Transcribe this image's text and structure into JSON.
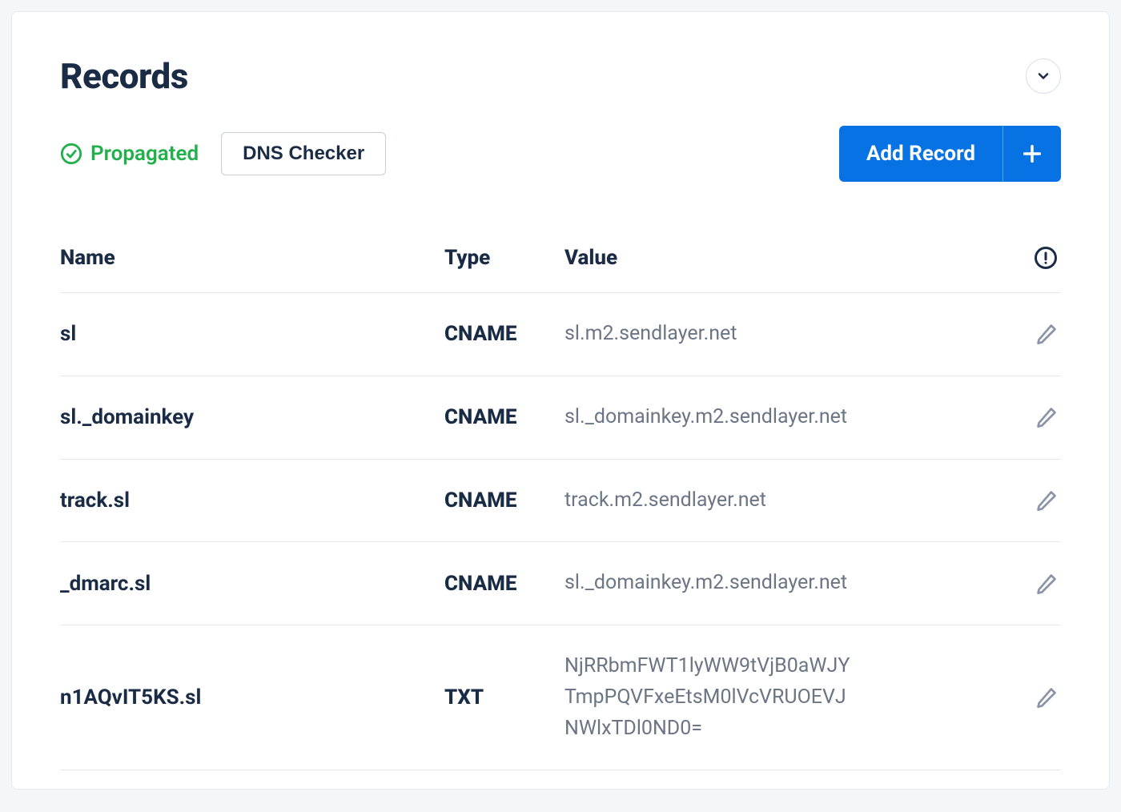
{
  "title": "Records",
  "status": {
    "label": "Propagated"
  },
  "buttons": {
    "dns_checker": "DNS Checker",
    "add_record": "Add Record"
  },
  "columns": {
    "name": "Name",
    "type": "Type",
    "value": "Value"
  },
  "rows": [
    {
      "name": "sl",
      "type": "CNAME",
      "value": "sl.m2.sendlayer.net"
    },
    {
      "name": "sl._domainkey",
      "type": "CNAME",
      "value": "sl._domainkey.m2.sendlayer.net"
    },
    {
      "name": "track.sl",
      "type": "CNAME",
      "value": "track.m2.sendlayer.net"
    },
    {
      "name": "_dmarc.sl",
      "type": "CNAME",
      "value": "sl._domainkey.m2.sendlayer.net"
    },
    {
      "name": "n1AQvIT5KS.sl",
      "type": "TXT",
      "value": "NjRRbmFWT1lyWW9tVjB0aWJYTmpPQVFxeEtsM0lVcVRUOEVJNWlxTDl0ND0="
    }
  ]
}
